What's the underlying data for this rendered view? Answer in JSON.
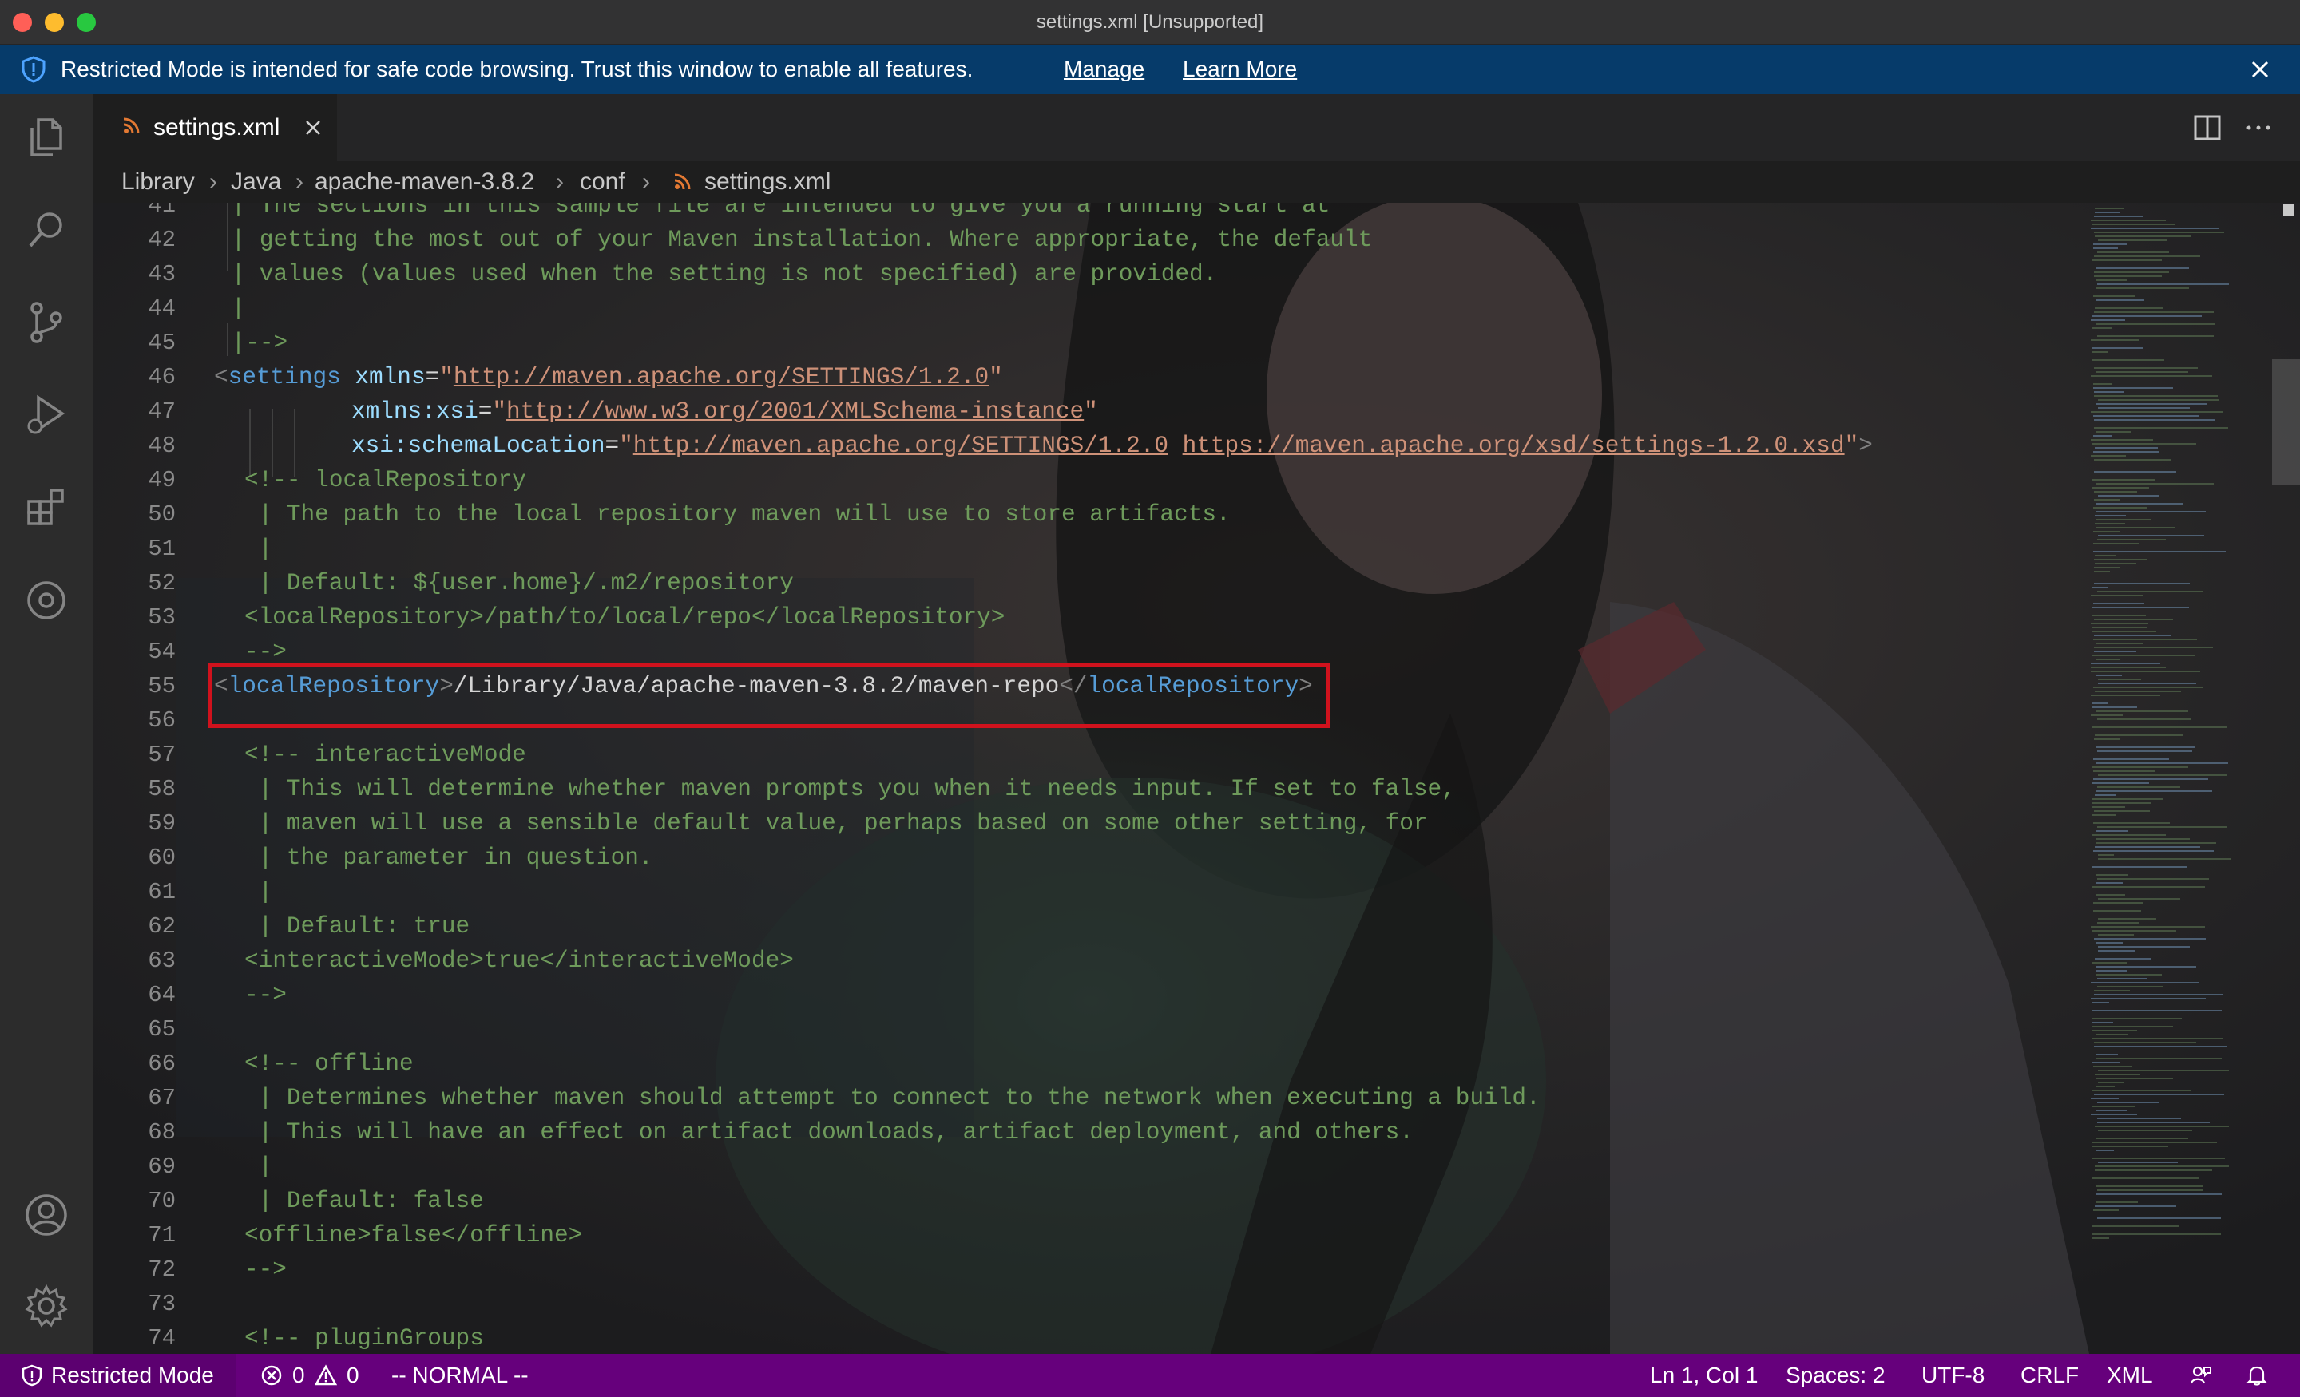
{
  "window": {
    "title": "settings.xml [Unsupported]"
  },
  "banner": {
    "message": "Restricted Mode is intended for safe code browsing. Trust this window to enable all features.",
    "manage": "Manage",
    "learn_more": "Learn More",
    "icon": "shield-icon",
    "background": "#063b6a"
  },
  "activity_bar": {
    "items": [
      "explorer-icon",
      "search-icon",
      "source-control-icon",
      "run-debug-icon",
      "extensions-icon",
      "remote-icon"
    ],
    "bottom": [
      "account-icon",
      "gear-icon"
    ]
  },
  "tabs": [
    {
      "label": "settings.xml",
      "icon": "rss-icon",
      "active": true
    }
  ],
  "breadcrumb": [
    "Library",
    "Java",
    "apache-maven-3.8.2",
    "conf",
    "settings.xml"
  ],
  "editor": {
    "line_numbers": [
      "41",
      "42",
      "43",
      "44",
      "45",
      "46",
      "47",
      "48",
      "49",
      "50",
      "51",
      "52",
      "53",
      "54",
      "55",
      "56",
      "57",
      "58",
      "59",
      "60",
      "61",
      "62",
      "63",
      "64",
      "65",
      "66",
      "67",
      "68",
      "69",
      "70",
      "71",
      "72",
      "73",
      "74"
    ],
    "lines": {
      "l41": " | The sections in this sample file are intended to give you a running start at",
      "l42": " | getting the most out of your Maven installation. Where appropriate, the default",
      "l43": " | values (values used when the setting is not specified) are provided.",
      "l44": " |",
      "l45": " |-->",
      "l46_tag": "settings",
      "l46_attr": "xmlns",
      "l46_val": "http://maven.apache.org/SETTINGS/1.2.0",
      "l47_attr": "xmlns:xsi",
      "l47_val": "http://www.w3.org/2001/XMLSchema-instance",
      "l48_attr": "xsi:schemaLocation",
      "l48_val1": "http://maven.apache.org/SETTINGS/1.2.0",
      "l48_val2": "https://maven.apache.org/xsd/settings-1.2.0.xsd",
      "l49": "<!-- localRepository",
      "l50": " | The path to the local repository maven will use to store artifacts.",
      "l51": " |",
      "l52": " | Default: ${user.home}/.m2/repository",
      "l53": "<localRepository>/path/to/local/repo</localRepository>",
      "l54": "-->",
      "l55_tag": "localRepository",
      "l55_text": "/Library/Java/apache-maven-3.8.2/maven-repo",
      "l57": "<!-- interactiveMode",
      "l58": " | This will determine whether maven prompts you when it needs input. If set to false,",
      "l59": " | maven will use a sensible default value, perhaps based on some other setting, for",
      "l60": " | the parameter in question.",
      "l61": " |",
      "l62": " | Default: true",
      "l63": "<interactiveMode>true</interactiveMode>",
      "l64": "-->",
      "l66": "<!-- offline",
      "l67": " | Determines whether maven should attempt to connect to the network when executing a build.",
      "l68": " | This will have an effect on artifact downloads, artifact deployment, and others.",
      "l69": " |",
      "l70": " | Default: false",
      "l71": "<offline>false</offline>",
      "l72": "-->",
      "l74": "<!-- pluginGroups"
    }
  },
  "status_bar": {
    "restricted": "Restricted Mode",
    "errors": "0",
    "warnings": "0",
    "vim_mode": "-- NORMAL --",
    "position": "Ln 1, Col 1",
    "spaces": "Spaces: 2",
    "encoding": "UTF-8",
    "eol": "CRLF",
    "language": "XML",
    "background": "#66007c"
  }
}
